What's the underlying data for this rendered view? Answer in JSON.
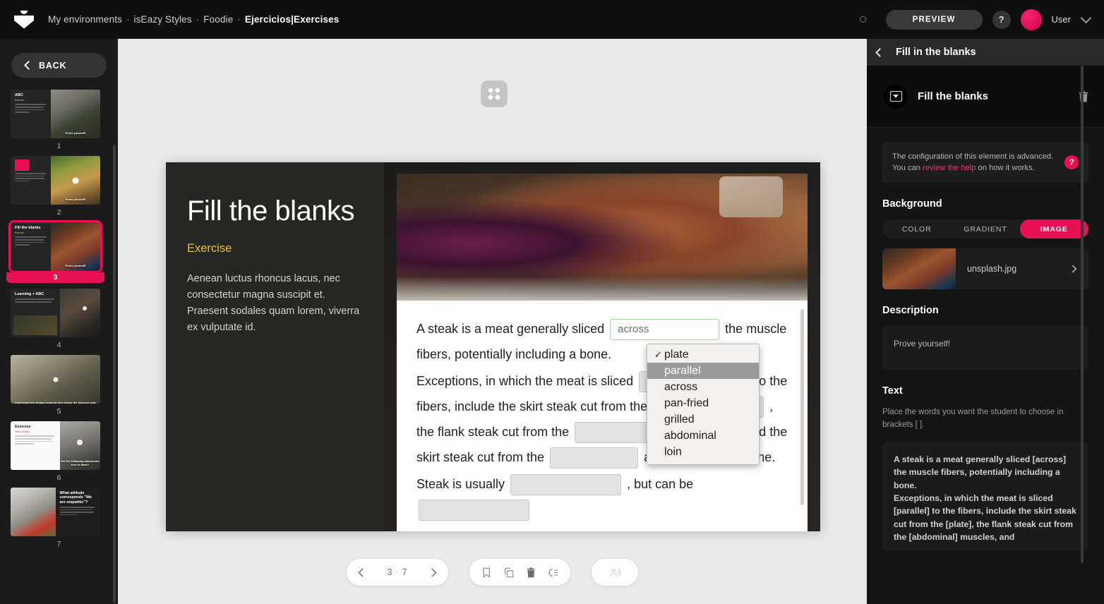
{
  "topbar": {
    "logo_icon": "isezy-logo-icon",
    "breadcrumb": {
      "items": [
        "My environments",
        "isEazy Styles",
        "Foodie"
      ],
      "current": "Ejercicios|Exercises",
      "separator": "·"
    },
    "status_dot_icon": "circle-outline-icon",
    "preview_label": "PREVIEW",
    "help_label": "?",
    "user_label": "User",
    "chevron_icon": "chevron-down-icon",
    "accent_color": "#e81154"
  },
  "sidebar": {
    "back_label": "BACK",
    "back_icon": "chevron-left-icon",
    "slides": [
      {
        "number": "1",
        "title": "ABC",
        "subtitle": "Exercise",
        "caption": "Prove yourself!",
        "layout": "split"
      },
      {
        "number": "2",
        "title": "",
        "subtitle": "Exercise",
        "caption": "Prove yourself!",
        "layout": "split"
      },
      {
        "number": "3",
        "title": "Fill the blanks",
        "subtitle": "Exercise",
        "caption": "Prove yourself!",
        "layout": "split",
        "selected": true
      },
      {
        "number": "4",
        "title": "Learning + ABC",
        "subtitle": "",
        "caption": "",
        "layout": "split"
      },
      {
        "number": "5",
        "title": "",
        "subtitle": "",
        "caption": "Understand the impact moment they shape the learning style",
        "layout": "full"
      },
      {
        "number": "6",
        "title": "Exercise",
        "subtitle": "True or False",
        "caption": "Are the following statements true or false?",
        "layout": "split"
      },
      {
        "number": "7",
        "title": "What attitude corresponds \"We are empathic\"?",
        "subtitle": "",
        "caption": "",
        "layout": "split"
      }
    ]
  },
  "canvas": {
    "move_handle_icon": "move-icon",
    "slide": {
      "title": "Fill the blanks",
      "subtitle": "Exercise",
      "body": "Aenean luctus rhoncus lacus, nec consectetur magna suscipit et. Praesent sodales quam lorem, viverra ex vulputate id.",
      "text_fragments": {
        "f1": "A steak is a meat generally sliced",
        "filled_value": "across",
        "f2": "the muscle fibers, potentially including a bone.",
        "f3": "Exceptions, in which the meat is sliced",
        "f4": "to the fibers, include the skirt steak cut from the",
        "f5": ", the flank steak cut from the",
        "f6": "muscles, and the skirt steak cut",
        "f7": "from the",
        "f8": "and including the bone.",
        "f9": "Steak is usually",
        "f10": ", but can be"
      }
    },
    "dropdown": {
      "selected": "plate",
      "highlighted": "parallel",
      "check_icon": "check-icon",
      "options": [
        "plate",
        "parallel",
        "across",
        "pan-fried",
        "grilled",
        "abdominal",
        "loin"
      ]
    },
    "bottombar": {
      "prev_icon": "chevron-left-icon",
      "next_icon": "chevron-right-icon",
      "current_page": "3",
      "page_separator": "·",
      "total_pages": "7",
      "tools": [
        "bookmark-icon",
        "duplicate-icon",
        "trash-icon",
        "list-order-icon"
      ],
      "audio_icon": "audio-narration-icon"
    }
  },
  "rightpanel": {
    "back_icon": "chevron-left-icon",
    "title": "Fill in the blanks",
    "element": {
      "icon": "dropdown-field-icon",
      "name": "Fill the blanks",
      "delete_icon": "trash-icon"
    },
    "notice": {
      "text_before": "The configuration of this element is advanced. You can ",
      "link": "review the help",
      "text_after": " on how it works.",
      "help_icon": "question-circle-icon"
    },
    "background": {
      "heading": "Background",
      "tabs": [
        "COLOR",
        "GRADIENT",
        "IMAGE"
      ],
      "active_tab": "IMAGE",
      "file_name": "unsplash.jpg",
      "file_chevron_icon": "chevron-right-icon"
    },
    "description": {
      "heading": "Description",
      "value": "Prove yourself!"
    },
    "text": {
      "heading": "Text",
      "hint": "Place the words you want the student to choose in brackets [ ].",
      "value": "A steak is a meat generally sliced [across] the muscle fibers, potentially including a bone.\nExceptions, in which the meat is sliced [parallel] to the fibers, include the skirt steak cut from the [plate], the flank steak cut from the [abdominal] muscles, and"
    }
  }
}
